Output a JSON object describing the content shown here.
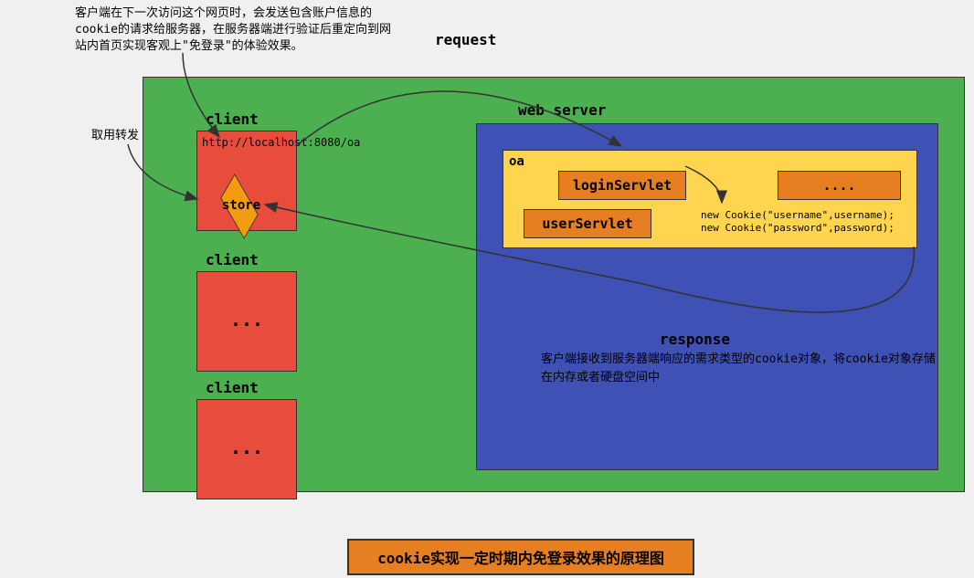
{
  "annotation_top": "客户端在下一次访问这个网页时，会发送包含账户信息的cookie的请求给服务器，在服务器端进行验证后重定向到网站内首页实现客观上\"免登录\"的体验效果。",
  "label_request": "request",
  "label_forward": "取用转发",
  "client1": {
    "label": "client",
    "url": "http://localhost:8080/oa",
    "store": "store"
  },
  "client2": {
    "label": "client",
    "dots": "..."
  },
  "client3": {
    "label": "client",
    "dots": "..."
  },
  "server": {
    "label": "web server",
    "oa": {
      "label": "oa",
      "login_servlet": "loginServlet",
      "user_servlet": "userServlet",
      "other": "....",
      "code1": "new Cookie(\"username\",username);",
      "code2": "new Cookie(\"password\",password);"
    },
    "response": {
      "label": "response",
      "text": "客户端接收到服务器端响应的需求类型的cookie对象，将cookie对象存储在内存或者硬盘空间中"
    }
  },
  "title": "cookie实现一定时期内免登录效果的原理图"
}
